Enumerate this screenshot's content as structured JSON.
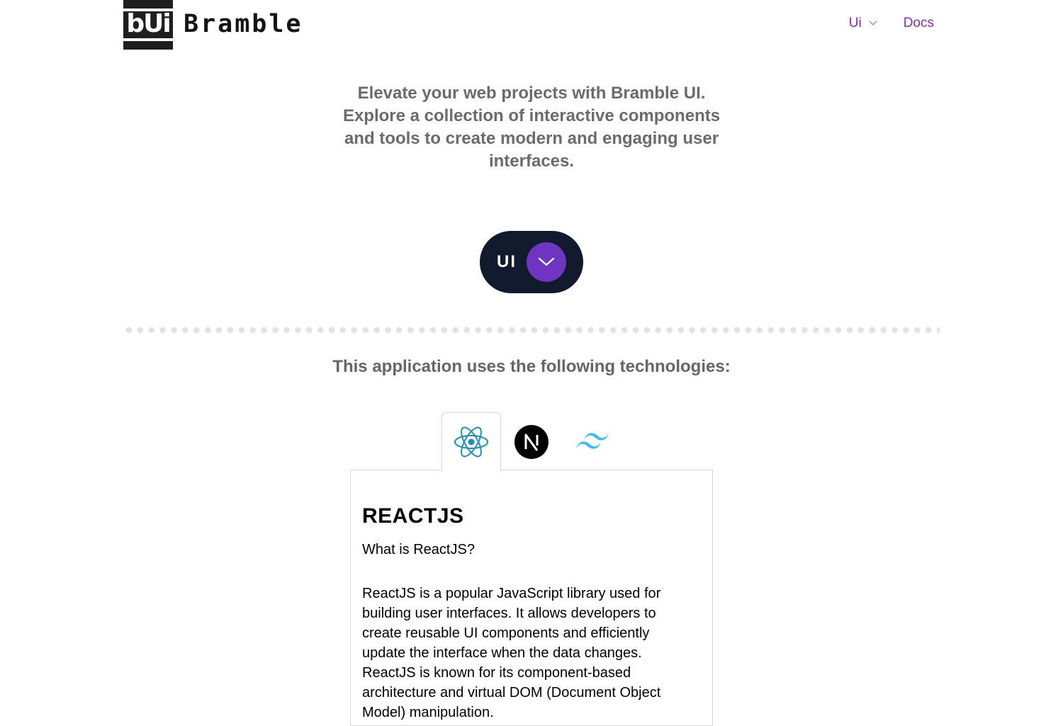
{
  "header": {
    "logo_text": "bUi",
    "brand_name": "Bramble",
    "nav": [
      {
        "label": "Ui",
        "has_dropdown": true
      },
      {
        "label": "Docs",
        "has_dropdown": false
      }
    ],
    "nav_color": "#8b2bb8"
  },
  "hero": {
    "text": "Elevate your web projects with Bramble UI. Explore a collection of interactive components and tools to create modern and engaging user interfaces."
  },
  "ui_button": {
    "label": "UI",
    "icon": "chevron-down-icon",
    "bg_color": "#121a2e",
    "accent_color": "#6d35c2"
  },
  "technologies": {
    "heading": "This application uses the following technologies:",
    "tabs": [
      {
        "icon": "react-icon",
        "active": true
      },
      {
        "icon": "nextjs-icon",
        "active": false
      },
      {
        "icon": "tailwind-icon",
        "active": false
      }
    ],
    "panel": {
      "title": "REACTJS",
      "subtitle": "What is ReactJS?",
      "body": "ReactJS is a popular JavaScript library used for building user interfaces. It allows developers to create reusable UI components and efficiently update the interface when the data changes. ReactJS is known for its component-based architecture and virtual DOM (Document Object Model) manipulation."
    }
  }
}
